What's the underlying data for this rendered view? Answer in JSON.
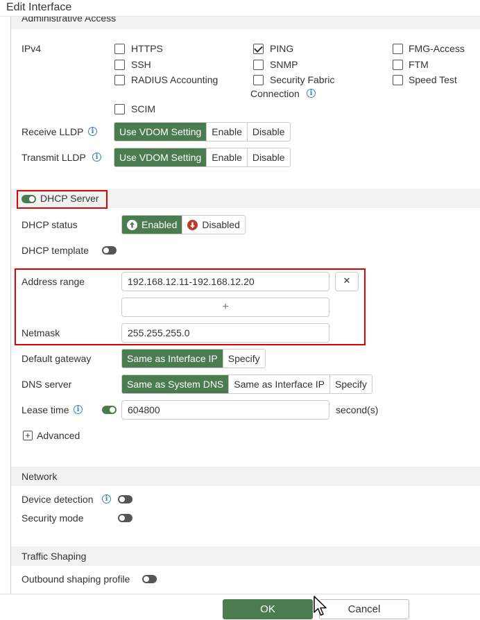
{
  "window": {
    "title": "Edit Interface"
  },
  "admin_access": {
    "section_title": "Administrative Access",
    "row_label": "IPv4",
    "options": [
      {
        "label": "HTTPS",
        "checked": false
      },
      {
        "label": "SSH",
        "checked": false
      },
      {
        "label": "RADIUS Accounting",
        "checked": false
      },
      {
        "label": "SCIM",
        "checked": false
      },
      {
        "label": "PING",
        "checked": true
      },
      {
        "label": "SNMP",
        "checked": false
      },
      {
        "label": "Security Fabric",
        "label2": "Connection",
        "checked": false
      },
      {
        "label": "FMG-Access",
        "checked": false
      },
      {
        "label": "FTM",
        "checked": false
      },
      {
        "label": "Speed Test",
        "checked": false
      }
    ]
  },
  "lldp": {
    "receive_label": "Receive LLDP",
    "transmit_label": "Transmit LLDP",
    "options": [
      "Use VDOM Setting",
      "Enable",
      "Disable"
    ],
    "selected": "Use VDOM Setting"
  },
  "dhcp": {
    "section_title": "DHCP Server",
    "enabled": true,
    "status_label": "DHCP status",
    "status_options": [
      "Enabled",
      "Disabled"
    ],
    "status_selected": "Enabled",
    "template_label": "DHCP template",
    "template_on": false,
    "address_range_label": "Address range",
    "address_range_value": "192.168.12.11-192.168.12.20",
    "add_symbol": "+",
    "remove_symbol": "✕",
    "netmask_label": "Netmask",
    "netmask_value": "255.255.255.0",
    "gateway_label": "Default gateway",
    "gateway_options": [
      "Same as Interface IP",
      "Specify"
    ],
    "gateway_selected": "Same as Interface IP",
    "dns_label": "DNS server",
    "dns_options": [
      "Same as System DNS",
      "Same as Interface IP",
      "Specify"
    ],
    "dns_selected": "Same as System DNS",
    "lease_label": "Lease time",
    "lease_on": true,
    "lease_value": "604800",
    "lease_unit": "second(s)",
    "advanced_label": "Advanced",
    "advanced_symbol": "+"
  },
  "network": {
    "section_title": "Network",
    "device_detection_label": "Device detection",
    "security_mode_label": "Security mode"
  },
  "traffic_shaping": {
    "section_title": "Traffic Shaping",
    "outbound_label": "Outbound shaping profile"
  },
  "footer": {
    "ok_label": "OK",
    "cancel_label": "Cancel"
  },
  "colors": {
    "accent": "#4a7c4f",
    "highlight": "#e00000",
    "info": "#3a7fbd",
    "disabled_icon": "#c0392b"
  }
}
